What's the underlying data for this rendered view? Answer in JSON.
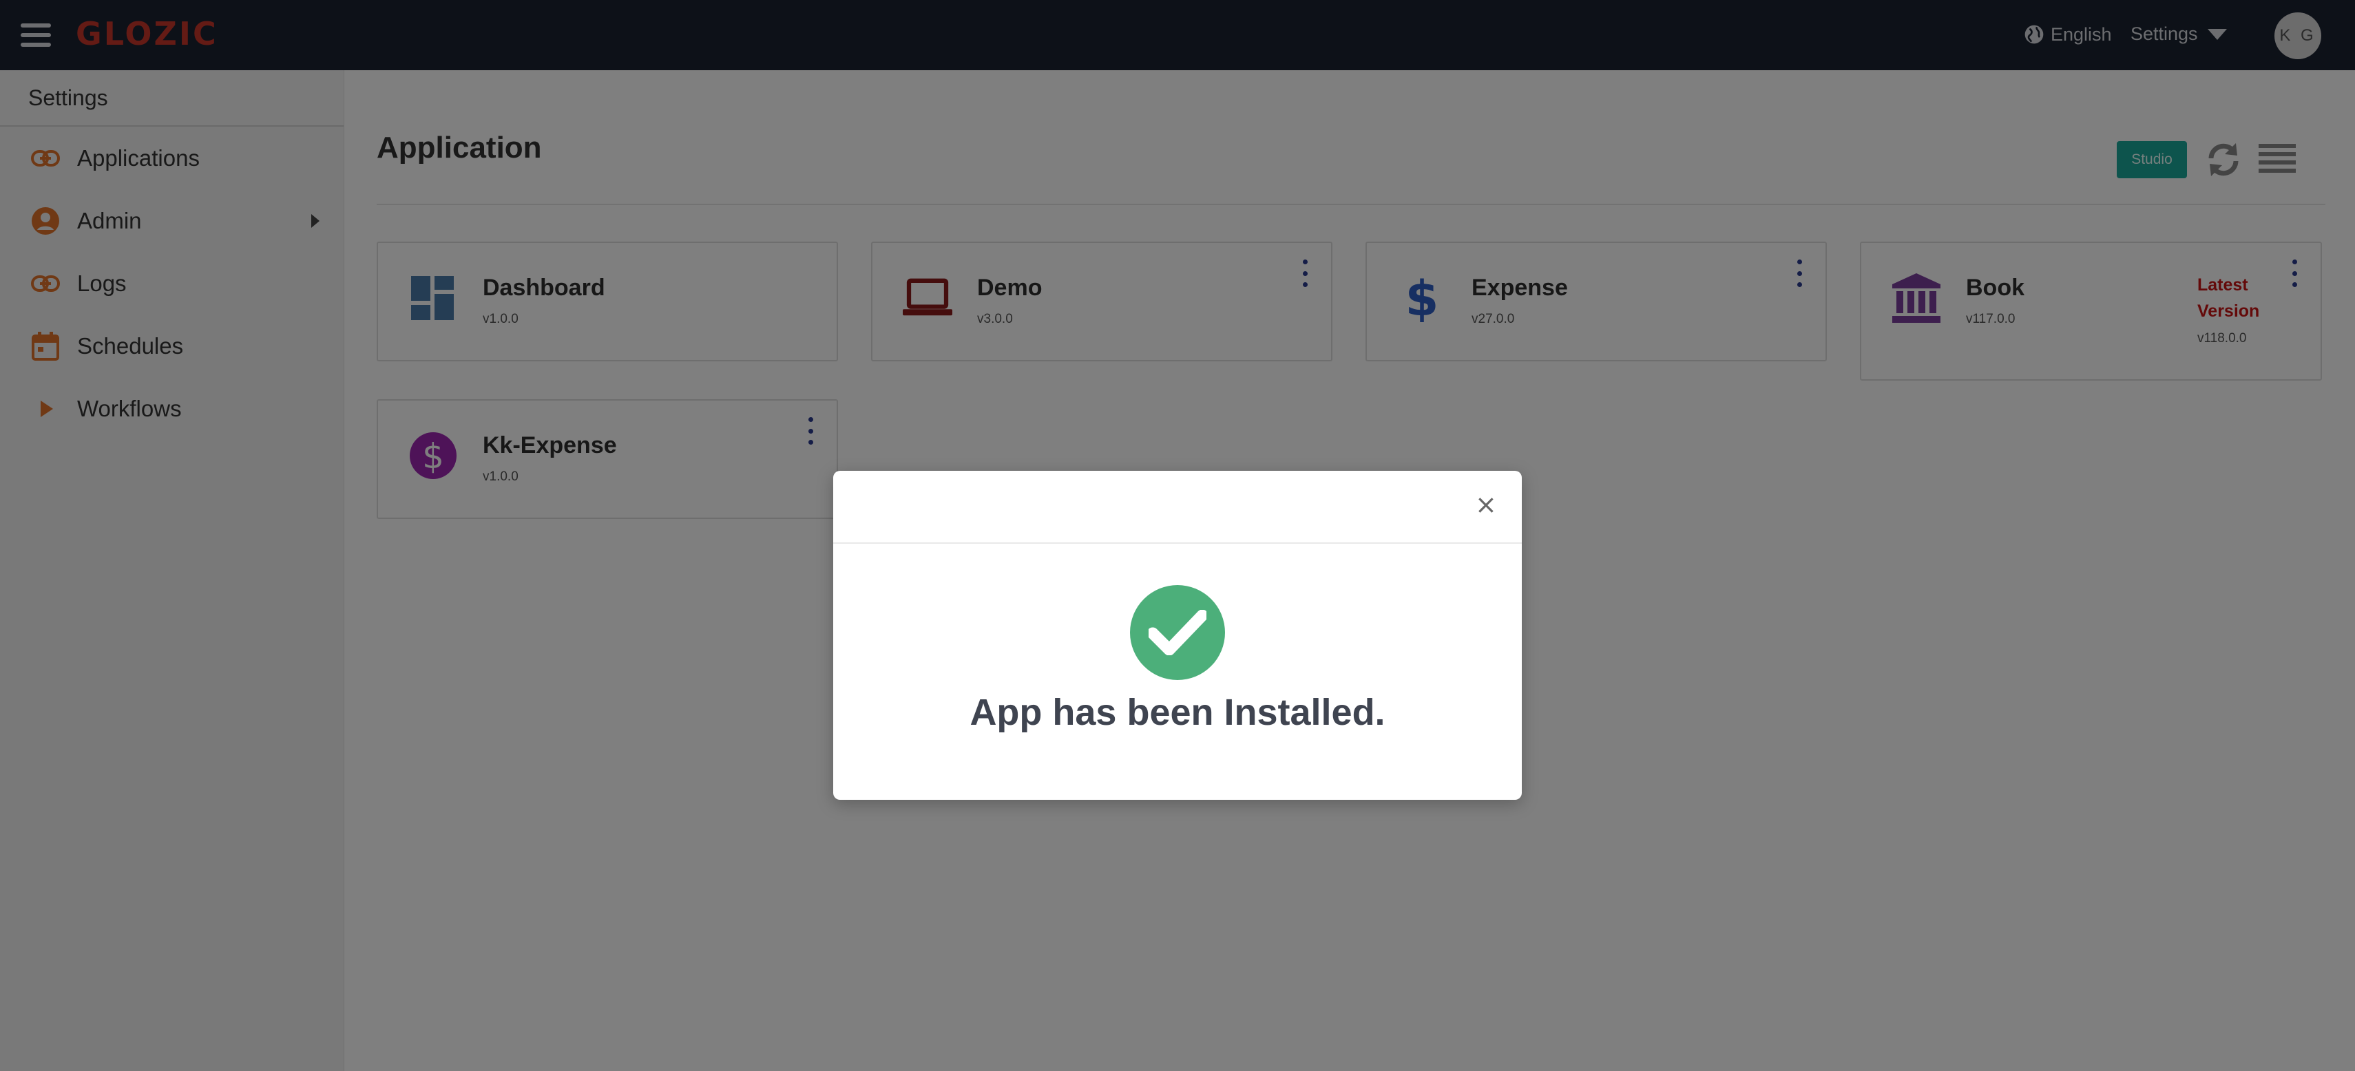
{
  "header": {
    "logo": "GLOZIC",
    "language": "English",
    "settings_label": "Settings",
    "avatar_initials": "K G"
  },
  "sidebar": {
    "title": "Settings",
    "items": [
      {
        "label": "Applications",
        "icon": "link-icon"
      },
      {
        "label": "Admin",
        "icon": "user-circle-icon"
      },
      {
        "label": "Logs",
        "icon": "link-icon"
      },
      {
        "label": "Schedules",
        "icon": "calendar-icon"
      },
      {
        "label": "Workflows",
        "icon": "play-icon"
      }
    ]
  },
  "main": {
    "title": "Application",
    "studio_label": "Studio",
    "apps": [
      {
        "name": "Dashboard",
        "version": "v1.0.0",
        "icon": "dashboard-icon",
        "color": "#4a7aa8"
      },
      {
        "name": "Demo",
        "version": "v3.0.0",
        "icon": "laptop-icon",
        "color": "#8b1a1a"
      },
      {
        "name": "Expense",
        "version": "v27.0.0",
        "icon": "dollar-icon",
        "color": "#2f5fc4"
      },
      {
        "name": "Book",
        "version": "v117.0.0",
        "icon": "bank-icon",
        "color": "#7a3e9d",
        "latest_label": "Latest Version",
        "latest_version": "v118.0.0"
      },
      {
        "name": "Kk-Expense",
        "version": "v1.0.0",
        "icon": "dollar-circle-icon",
        "color": "#9c27b0"
      }
    ]
  },
  "modal": {
    "close_symbol": "×",
    "message": "App has been Installed.",
    "icon": "check-circle-icon",
    "success_color": "#4caf7a"
  },
  "colors": {
    "topbar": "#1b2231",
    "accent_orange": "#e0732a",
    "studio_button": "#1aa89a"
  }
}
